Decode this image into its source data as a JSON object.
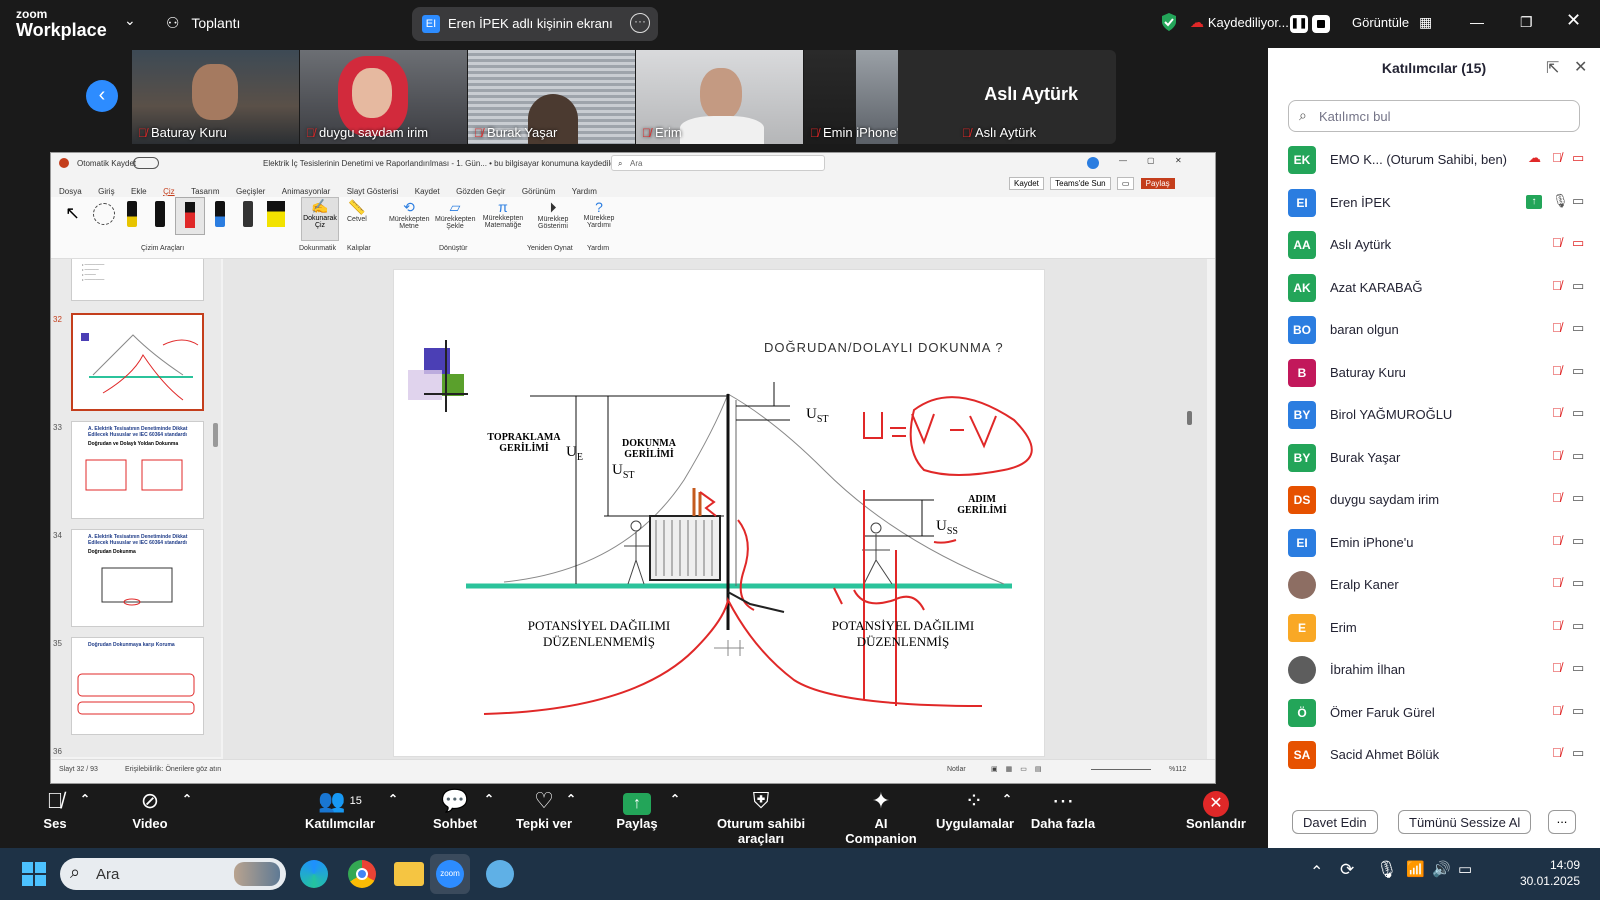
{
  "topbar": {
    "logo_line1": "zoom",
    "logo_line2": "Workplace",
    "meeting_label": "Toplantı",
    "share_badge": "EI",
    "share_text": "Eren İPEK adlı kişinin ekranı",
    "recording_text": "Kaydediliyor...",
    "view_label": "Görüntüle"
  },
  "strip": {
    "tiles": [
      {
        "name": "Baturay Kuru"
      },
      {
        "name": "duygu saydam irim"
      },
      {
        "name": "Burak Yaşar"
      },
      {
        "name": "Erim"
      },
      {
        "name": "Emin iPhone'u"
      },
      {
        "name": "Aslı Aytürk",
        "big_name": "Aslı Aytürk"
      }
    ]
  },
  "ppt": {
    "autosave": "Otomatik Kaydet",
    "doc_title": "Elektrik İç Tesislerinin Denetimi ve Raporlandırılması - 1. Gün... • bu bilgisayar konumuna kaydedildi",
    "search_placeholder": "Ara",
    "record_btn": "Kaydet",
    "teams_btn": "Teams'de Sun",
    "share_btn": "Paylaş",
    "menu": [
      "Dosya",
      "Giriş",
      "Ekle",
      "Çiz",
      "Tasarım",
      "Geçişler",
      "Animasyonlar",
      "Slayt Gösterisi",
      "Kaydet",
      "Gözden Geçir",
      "Görünüm",
      "Yardım"
    ],
    "ribbon_groups": {
      "drawing_tools": "Çizim Araçları",
      "touch_draw": "Dokunarak Çiz",
      "touch": "Dokunmatik",
      "ruler": "Cetvel",
      "stencils": "Kalıplar",
      "ink_to_text": "Mürekkepten Metne",
      "ink_to_shape": "Mürekkepten Şekle",
      "ink_to_math": "Mürekkepten Matematiğe",
      "convert": "Dönüştür",
      "ink_replay": "Mürekkep Gösterimi",
      "replay": "Yeniden Oynat",
      "ink_help": "Mürekkep Yardımı",
      "help": "Yardım"
    },
    "thumbs": [
      {
        "num": "32",
        "title": ""
      },
      {
        "num": "33",
        "title": "A. Elektrik Tesisatının Denetiminde Dikkat Edilecek Hususlar ve IEC 60364 standardı",
        "subtitle": "Doğrudan ve Dolaylı Yoldan Dokunma"
      },
      {
        "num": "34",
        "title": "A. Elektrik Tesisatının Denetiminde Dikkat Edilecek Hususlar ve IEC 60364 standardı",
        "subtitle": "Doğrudan Dokunma"
      },
      {
        "num": "35",
        "title": "Doğrudan Dokunmaya karşı Koruma"
      },
      {
        "num": "36",
        "title": ""
      }
    ],
    "slide": {
      "title": "DOĞRUDAN/DOLAYLI DOKUNMA ?",
      "topraklama": "TOPRAKLAMA",
      "gerilimi1": "GERİLİMİ",
      "dokunma": "DOKUNMA",
      "gerilimi2": "GERİLİMİ",
      "adim": "ADIM",
      "gerilimi3": "GERİLİMİ",
      "ue": "U",
      "ue_sub": "E",
      "ust1": "U",
      "ust1_sub": "ST",
      "ust2": "U",
      "ust2_sub": "ST",
      "uss": "U",
      "uss_sub": "SS",
      "left_caption1": "POTANSİYEL DAĞILIMI",
      "left_caption2": "DÜZENLENMEMİŞ",
      "right_caption1": "POTANSİYEL DAĞILIMI",
      "right_caption2": "DÜZENLENMİŞ"
    },
    "status_left": "Slayt 32 / 93",
    "status_access": "Erişilebilirlik: Önerilere göz atın",
    "status_notes": "Notlar",
    "status_zoom": "%112"
  },
  "panel": {
    "title": "Katılımcılar (15)",
    "search_placeholder": "Katılımcı bul",
    "participants": [
      {
        "initials": "EK",
        "name": "EMO K...  (Oturum Sahibi, ben)",
        "color": "#23a559"
      },
      {
        "initials": "EI",
        "name": "Eren İPEK",
        "color": "#2b7de0"
      },
      {
        "initials": "AA",
        "name": "Aslı Aytürk",
        "color": "#23a559"
      },
      {
        "initials": "AK",
        "name": "Azat KARABAĞ",
        "color": "#23a559"
      },
      {
        "initials": "BO",
        "name": "baran  olgun",
        "color": "#2b7de0"
      },
      {
        "initials": "B",
        "name": "Baturay Kuru",
        "color": "#c2185b"
      },
      {
        "initials": "BY",
        "name": "Birol YAĞMUROĞLU",
        "color": "#2b7de0"
      },
      {
        "initials": "BY",
        "name": "Burak Yaşar",
        "color": "#23a559"
      },
      {
        "initials": "DS",
        "name": "duygu saydam irim",
        "color": "#e65100"
      },
      {
        "initials": "EI",
        "name": "Emin iPhone'u",
        "color": "#2b7de0"
      },
      {
        "initials": "",
        "name": "Eralp Kaner",
        "color": "#8d6e63"
      },
      {
        "initials": "E",
        "name": "Erim",
        "color": "#f9a825"
      },
      {
        "initials": "",
        "name": "İbrahim İlhan",
        "color": "#5d5d5d"
      },
      {
        "initials": "Ö",
        "name": "Ömer Faruk Gürel",
        "color": "#23a559"
      },
      {
        "initials": "SA",
        "name": "Sacid Ahmet Bölük",
        "color": "#e65100"
      }
    ],
    "invite_btn": "Davet Edin",
    "mute_all_btn": "Tümünü Sessize Al",
    "more_btn": "..."
  },
  "toolbar": {
    "audio": "Ses",
    "video": "Video",
    "participants": "Katılımcılar",
    "participants_count": "15",
    "chat": "Sohbet",
    "react": "Tepki ver",
    "share": "Paylaş",
    "host_tools": "Oturum sahibi araçları",
    "ai": "AI Companion",
    "apps": "Uygulamalar",
    "more": "Daha fazla",
    "end": "Sonlandır"
  },
  "taskbar": {
    "search": "Ara",
    "time": "14:09",
    "date": "30.01.2025"
  }
}
